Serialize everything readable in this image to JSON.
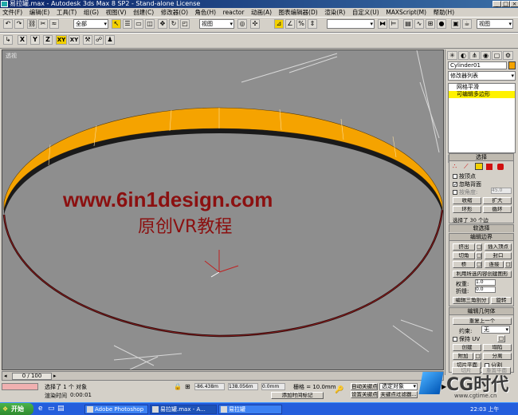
{
  "window": {
    "title": "易拉罐.max - Autodesk 3ds Max 8 SP2  - Stand-alone License",
    "buttons": [
      "_",
      "□",
      "×"
    ]
  },
  "menu": [
    "文件(F)",
    "编辑(E)",
    "工具(T)",
    "组(G)",
    "视图(V)",
    "创建(C)",
    "修改器(O)",
    "角色(H)",
    "reactor",
    "动画(A)",
    "图表编辑器(D)",
    "渲染(R)",
    "自定义(U)",
    "MAXScript(M)",
    "帮助(H)"
  ],
  "toolbar": {
    "selection_filter": "全部",
    "ref_coord": "视图",
    "named_selection": "",
    "axis": [
      "X",
      "Y",
      "Z",
      "XY",
      "XY"
    ],
    "view_label": "视图"
  },
  "viewport": {
    "label": "透视",
    "watermark_url": "www.6in1design.com",
    "watermark_cn": "原创VR教程",
    "accent_color": "#f5a300",
    "watermark_color": "#8b1010"
  },
  "command_panel": {
    "object_name": "Cylinder01",
    "modifier_list": "修改器列表",
    "stack": [
      "网格平滑",
      "可编辑多边形"
    ],
    "selection": {
      "header": "选择",
      "by_vertex": "按顶点",
      "ignore_backfacing": "忽略背面",
      "by_angle": "按角度:",
      "angle": "45.0",
      "shrink": "收缩",
      "grow": "扩大",
      "ring": "环形",
      "loop": "循环",
      "status": "选择了 30 个边"
    },
    "soft_selection": "软选择",
    "edit_edges": {
      "header": "编辑边界",
      "extrude": "挤出",
      "insert_vertex": "插入顶点",
      "chamfer": "切角",
      "cap": "封口",
      "bridge": "桥",
      "connect": "连接",
      "create_shape": "利用所选内容创建图形",
      "weight_label": "权重:",
      "weight": "1.0",
      "crease_label": "折缝:",
      "crease": "0.0",
      "edit_tri": "编辑三角剖分",
      "rotate": "旋转"
    },
    "edit_geometry": {
      "header": "编辑几何体",
      "repeat": "重复上一个",
      "constraint_label": "约束:",
      "constraint": "无",
      "preserve_uv": "保持 UV",
      "create": "创建",
      "collapse": "塌陷",
      "attach": "附加",
      "detach": "分离",
      "slice_plane": "切片平面",
      "split": "分割",
      "slice": "切片",
      "reset_plane": "重置平面"
    }
  },
  "timeline": {
    "frame": "0 / 100"
  },
  "status": {
    "selected": "选择了 1 个 对象",
    "render_time_label": "渲染时间",
    "render_time": "0:00:01",
    "x": "-86.438m",
    "y": "138.056m",
    "z": "0.0mm",
    "grid": "栅格 = 10.0mm",
    "add_time_tag": "添加时间标记",
    "auto_key": "自动关键点",
    "set_key": "设置关键点",
    "key_filter": "关键点过滤器...",
    "selected_dd": "选定对象"
  },
  "taskbar": {
    "start": "开始",
    "tasks": [
      "Adobe Photoshop",
      "易拉罐.max - A...",
      "易拉罐"
    ],
    "clock": "22:03 上午"
  },
  "logo": {
    "text": "CG时代",
    "url": "www.cgtime.cn"
  }
}
